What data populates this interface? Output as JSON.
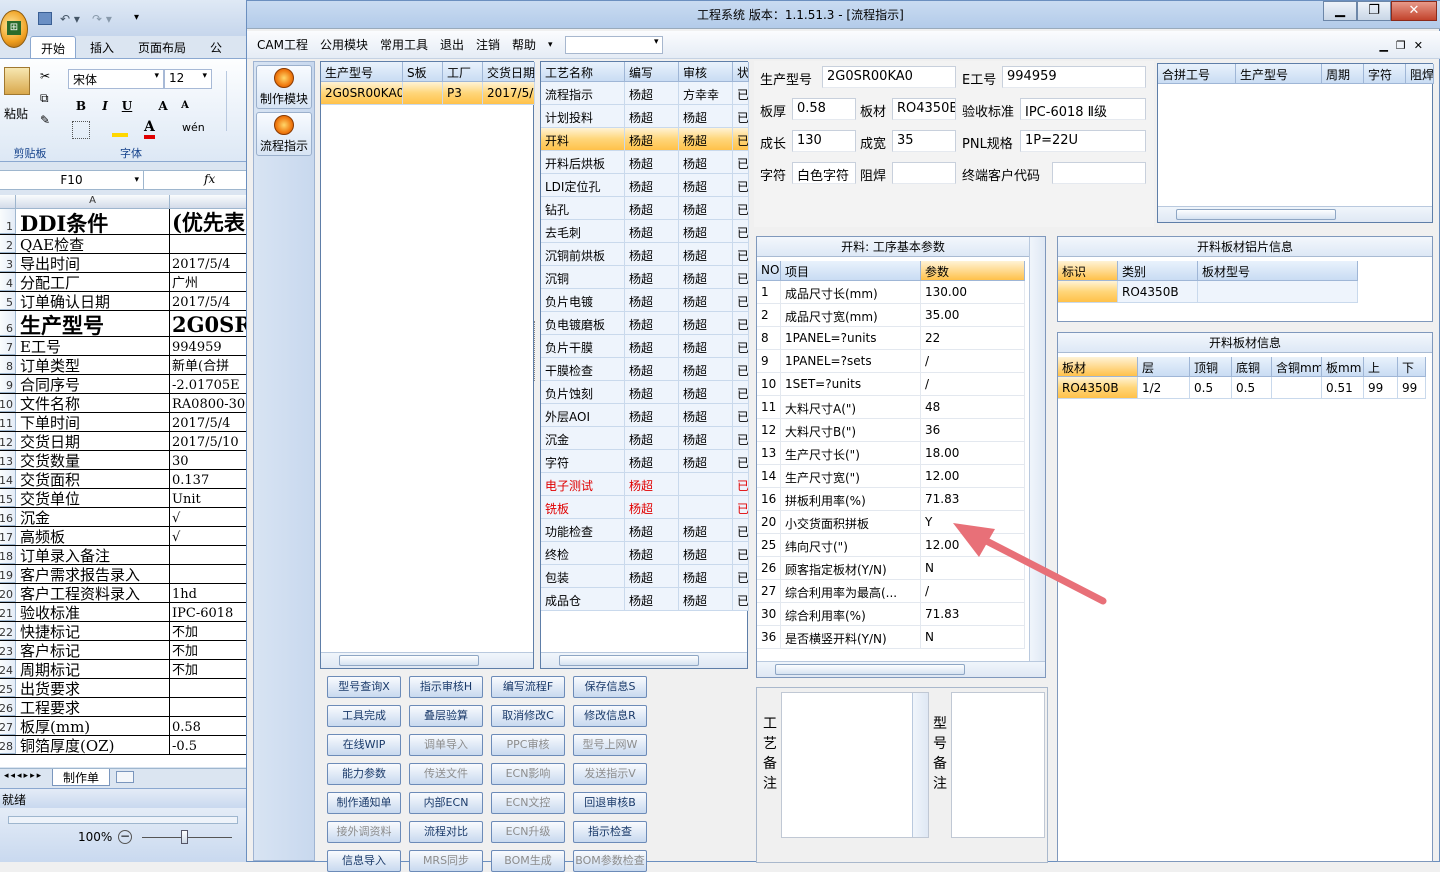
{
  "excel": {
    "tabs": [
      "开始",
      "插入",
      "页面布局",
      "公"
    ],
    "font_name": "宋体",
    "font_size": "12",
    "paste_label": "粘贴",
    "group_clipboard": "剪贴板",
    "group_font": "字体",
    "name_box": "F10",
    "fx": "fx",
    "col_a": "A",
    "rows": [
      {
        "n": "1",
        "a": "DDI条件",
        "b": "(优先表",
        "big": true
      },
      {
        "n": "2",
        "a": "QAE检查",
        "b": ""
      },
      {
        "n": "3",
        "a": "导出时间",
        "b": "2017/5/4"
      },
      {
        "n": "4",
        "a": "分配工厂",
        "b": "广州"
      },
      {
        "n": "5",
        "a": "订单确认日期",
        "b": "2017/5/4"
      },
      {
        "n": "6",
        "a": "生产型号",
        "b": "2G0SR0",
        "big": true
      },
      {
        "n": "7",
        "a": "E工号",
        "b": "994959"
      },
      {
        "n": "8",
        "a": "订单类型",
        "b": "新单(合拼"
      },
      {
        "n": "9",
        "a": "合同序号",
        "b": "-2.01705E"
      },
      {
        "n": "10",
        "a": "文件名称",
        "b": "RA0800-30"
      },
      {
        "n": "11",
        "a": "下单时间",
        "b": "2017/5/4"
      },
      {
        "n": "12",
        "a": "交货日期",
        "b": "2017/5/10"
      },
      {
        "n": "13",
        "a": "交货数量",
        "b": "30"
      },
      {
        "n": "14",
        "a": "交货面积",
        "b": "0.137"
      },
      {
        "n": "15",
        "a": "交货单位",
        "b": "Unit"
      },
      {
        "n": "16",
        "a": "沉金",
        "b": "√"
      },
      {
        "n": "17",
        "a": "高频板",
        "b": "√"
      },
      {
        "n": "18",
        "a": "订单录入备注",
        "b": ""
      },
      {
        "n": "19",
        "a": "客户需求报告录入",
        "b": ""
      },
      {
        "n": "20",
        "a": "客户工程资料录入",
        "b": "1hd"
      },
      {
        "n": "21",
        "a": "验收标准",
        "b": "IPC-6018"
      },
      {
        "n": "22",
        "a": "快捷标记",
        "b": "不加"
      },
      {
        "n": "23",
        "a": "客户标记",
        "b": "不加"
      },
      {
        "n": "24",
        "a": "周期标记",
        "b": "不加"
      },
      {
        "n": "25",
        "a": "出货要求",
        "b": ""
      },
      {
        "n": "26",
        "a": "工程要求",
        "b": ""
      },
      {
        "n": "27",
        "a": "板厚(mm)",
        "b": "0.58"
      },
      {
        "n": "28",
        "a": "铜箔厚度(OZ)",
        "b": "-0.5"
      }
    ],
    "sheet_tab": "制作单",
    "status": "就绪",
    "zoom": "100%"
  },
  "main": {
    "title": "工程系统  版本：1.1.51.3 - [流程指示]",
    "menu": [
      "CAM工程",
      "公用模块",
      "常用工具",
      "退出",
      "注销",
      "帮助"
    ],
    "left_toolbar": [
      "制作模块",
      "流程指示"
    ],
    "order_grid": {
      "headers": [
        "生产型号",
        "S板",
        "工厂",
        "交货日期"
      ],
      "rows": [
        [
          "2G0SR00KA0",
          "",
          "P3",
          "2017/5/"
        ]
      ]
    },
    "process_grid": {
      "headers": [
        "工艺名称",
        "编写",
        "审核",
        "状"
      ],
      "rows": [
        {
          "name": "流程指示",
          "w": "杨超",
          "r": "方幸幸",
          "s": "已",
          "red": false
        },
        {
          "name": "计划投料",
          "w": "杨超",
          "r": "杨超",
          "s": "已",
          "red": false
        },
        {
          "name": "开料",
          "w": "杨超",
          "r": "杨超",
          "s": "已",
          "red": false,
          "sel": true
        },
        {
          "name": "开料后烘板",
          "w": "杨超",
          "r": "杨超",
          "s": "已",
          "red": false
        },
        {
          "name": "LDI定位孔",
          "w": "杨超",
          "r": "杨超",
          "s": "已",
          "red": false
        },
        {
          "name": "钻孔",
          "w": "杨超",
          "r": "杨超",
          "s": "已",
          "red": false
        },
        {
          "name": "去毛刺",
          "w": "杨超",
          "r": "杨超",
          "s": "已",
          "red": false
        },
        {
          "name": "沉铜前烘板",
          "w": "杨超",
          "r": "杨超",
          "s": "已",
          "red": false
        },
        {
          "name": "沉铜",
          "w": "杨超",
          "r": "杨超",
          "s": "已",
          "red": false
        },
        {
          "name": "负片电镀",
          "w": "杨超",
          "r": "杨超",
          "s": "已",
          "red": false
        },
        {
          "name": "负电镀磨板",
          "w": "杨超",
          "r": "杨超",
          "s": "已",
          "red": false
        },
        {
          "name": "负片干膜",
          "w": "杨超",
          "r": "杨超",
          "s": "已",
          "red": false
        },
        {
          "name": "干膜检查",
          "w": "杨超",
          "r": "杨超",
          "s": "已",
          "red": false
        },
        {
          "name": "负片蚀刻",
          "w": "杨超",
          "r": "杨超",
          "s": "已",
          "red": false
        },
        {
          "name": "外层AOI",
          "w": "杨超",
          "r": "杨超",
          "s": "已",
          "red": false
        },
        {
          "name": "沉金",
          "w": "杨超",
          "r": "杨超",
          "s": "已",
          "red": false
        },
        {
          "name": "字符",
          "w": "杨超",
          "r": "杨超",
          "s": "已",
          "red": false
        },
        {
          "name": "电子测试",
          "w": "杨超",
          "r": "",
          "s": "已",
          "red": true
        },
        {
          "name": "铣板",
          "w": "杨超",
          "r": "",
          "s": "已",
          "red": true
        },
        {
          "name": "功能检查",
          "w": "杨超",
          "r": "杨超",
          "s": "已",
          "red": false
        },
        {
          "name": "终检",
          "w": "杨超",
          "r": "杨超",
          "s": "已",
          "red": false
        },
        {
          "name": "包装",
          "w": "杨超",
          "r": "杨超",
          "s": "已",
          "red": false
        },
        {
          "name": "成品仓",
          "w": "杨超",
          "r": "杨超",
          "s": "已",
          "red": false
        }
      ]
    },
    "info": {
      "model_label": "生产型号",
      "model": "2G0SR00KA0",
      "eno_label": "E工号",
      "eno": "994959",
      "thick_label": "板厚",
      "thick": "0.58",
      "mat_label": "板材",
      "mat": "RO4350B",
      "std_label": "验收标准",
      "std": "IPC-6018 Ⅱ级",
      "len_label": "成长",
      "len": "130",
      "wid_label": "成宽",
      "wid": "35",
      "pnl_label": "PNL规格",
      "pnl": "1P=22U",
      "char_label": "字符",
      "char": "白色字符",
      "mask_label": "阻焊",
      "mask": "",
      "cust_label": "终端客户代码",
      "cust": ""
    },
    "merge_grid": {
      "headers": [
        "合拼工号",
        "生产型号",
        "周期",
        "字符",
        "阻焊"
      ]
    },
    "params": {
      "title": "开料: 工序基本参数",
      "headers": [
        "NO",
        "项目",
        "参数"
      ],
      "rows": [
        [
          "1",
          "成品尺寸长(mm)",
          "130.00"
        ],
        [
          "2",
          "成品尺寸宽(mm)",
          "35.00"
        ],
        [
          "8",
          "1PANEL=?units",
          "22"
        ],
        [
          "9",
          "1PANEL=?sets",
          "/"
        ],
        [
          "10",
          "1SET=?units",
          "/"
        ],
        [
          "11",
          "大料尺寸A(\")",
          "48"
        ],
        [
          "12",
          "大料尺寸B(\")",
          "36"
        ],
        [
          "13",
          "生产尺寸长(\")",
          "18.00"
        ],
        [
          "14",
          "生产尺寸宽(\")",
          "12.00"
        ],
        [
          "16",
          "拼板利用率(%)",
          "71.83"
        ],
        [
          "20",
          "小交货面积拼板",
          "Y"
        ],
        [
          "25",
          "纬向尺寸(\")",
          "12.00"
        ],
        [
          "26",
          "顾客指定板材(Y/N)",
          "N"
        ],
        [
          "27",
          "综合利用率为最高(...",
          "/"
        ],
        [
          "30",
          "综合利用率(%)",
          "71.83"
        ],
        [
          "36",
          "是否横竖开料(Y/N)",
          "N"
        ]
      ]
    },
    "alu": {
      "title": "开料板材铝片信息",
      "headers": [
        "标识",
        "类别",
        "板材型号"
      ],
      "rows": [
        [
          "",
          "RO4350B",
          ""
        ]
      ]
    },
    "board": {
      "title": "开料板材信息",
      "headers": [
        "板材",
        "层",
        "顶铜",
        "底铜",
        "含铜mm",
        "板mm",
        "上",
        "下"
      ],
      "rows": [
        [
          "RO4350B",
          "1/2",
          "0.5",
          "0.5",
          "",
          "0.51",
          "99",
          "99"
        ]
      ]
    },
    "note1_label": "工艺备注",
    "note2_label": "型号备注",
    "buttons": [
      {
        "t": "型号查询X",
        "dis": false
      },
      {
        "t": "指示审核H",
        "dis": false
      },
      {
        "t": "编写流程F",
        "dis": false
      },
      {
        "t": "保存信息S",
        "dis": false
      },
      {
        "t": "工具完成",
        "dis": false
      },
      {
        "t": "叠层验算",
        "dis": false
      },
      {
        "t": "取消修改C",
        "dis": false
      },
      {
        "t": "修改信息R",
        "dis": false
      },
      {
        "t": "在线WIP",
        "dis": false
      },
      {
        "t": "调单导入",
        "dis": true
      },
      {
        "t": "PPC审核",
        "dis": true
      },
      {
        "t": "型号上网W",
        "dis": true
      },
      {
        "t": "能力参数",
        "dis": false
      },
      {
        "t": "传送文件",
        "dis": true
      },
      {
        "t": "ECN影响",
        "dis": true
      },
      {
        "t": "发送指示V",
        "dis": true
      },
      {
        "t": "制作通知单",
        "dis": false
      },
      {
        "t": "内部ECN",
        "dis": false
      },
      {
        "t": "ECN文控",
        "dis": true
      },
      {
        "t": "回退审核B",
        "dis": false
      },
      {
        "t": "接外调资料",
        "dis": true
      },
      {
        "t": "流程对比",
        "dis": false
      },
      {
        "t": "ECN升级",
        "dis": true
      },
      {
        "t": "指示检查",
        "dis": false
      },
      {
        "t": "信息导入",
        "dis": false
      },
      {
        "t": "MRS同步",
        "dis": true
      },
      {
        "t": "BOM生成",
        "dis": true
      },
      {
        "t": "BOM参数检查",
        "dis": true
      }
    ]
  }
}
